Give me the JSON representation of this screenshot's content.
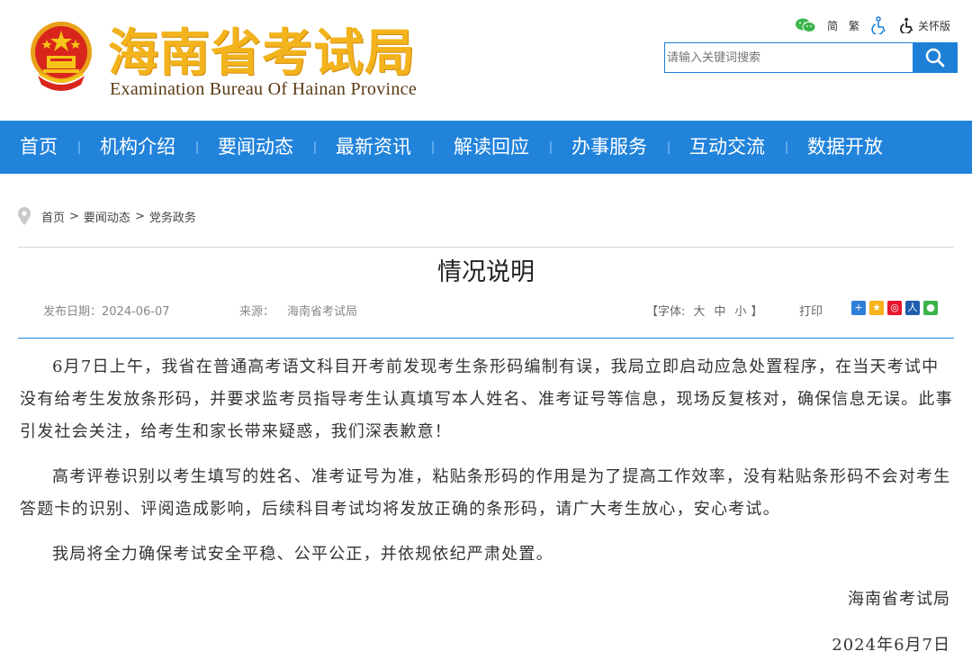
{
  "header": {
    "title": "海南省考试局",
    "subtitle": "Examination Bureau Of Hainan Province"
  },
  "tools": {
    "simplified": "简",
    "traditional": "繁",
    "care_mode": "关怀版"
  },
  "search": {
    "placeholder": "请输入关键词搜索"
  },
  "nav": {
    "items": [
      "首页",
      "机构介绍",
      "要闻动态",
      "最新资讯",
      "解读回应",
      "办事服务",
      "互动交流",
      "数据开放"
    ]
  },
  "breadcrumb": {
    "items": [
      "首页",
      "要闻动态",
      "党务政务"
    ],
    "separator": ">"
  },
  "article": {
    "title": "情况说明",
    "date_label": "发布日期：2024-06-07",
    "source_label": "来源：",
    "source": "海南省考试局",
    "font_open": "【字体:",
    "font_large": "大",
    "font_medium": "中",
    "font_small": "小",
    "font_close": "】",
    "print": "打印",
    "paragraphs": [
      "6月7日上午，我省在普通高考语文科目开考前发现考生条形码编制有误，我局立即启动应急处置程序，在当天考试中没有给考生发放条形码，并要求监考员指导考生认真填写本人姓名、准考证号等信息，现场反复核对，确保信息无误。此事引发社会关注，给考生和家长带来疑惑，我们深表歉意！",
      "高考评卷识别以考生填写的姓名、准考证号为准，粘贴条形码的作用是为了提高工作效率，没有粘贴条形码不会对考生答题卡的识别、评阅造成影响，后续科目考试均将发放正确的条形码，请广大考生放心，安心考试。",
      "我局将全力确保考试安全平稳、公平公正，并依规依纪严肃处置。"
    ],
    "signature_org": "海南省考试局",
    "signature_date": "2024年6月7日"
  },
  "colors": {
    "nav_bg": "#2283db",
    "title_gold": "#f2b31c"
  }
}
